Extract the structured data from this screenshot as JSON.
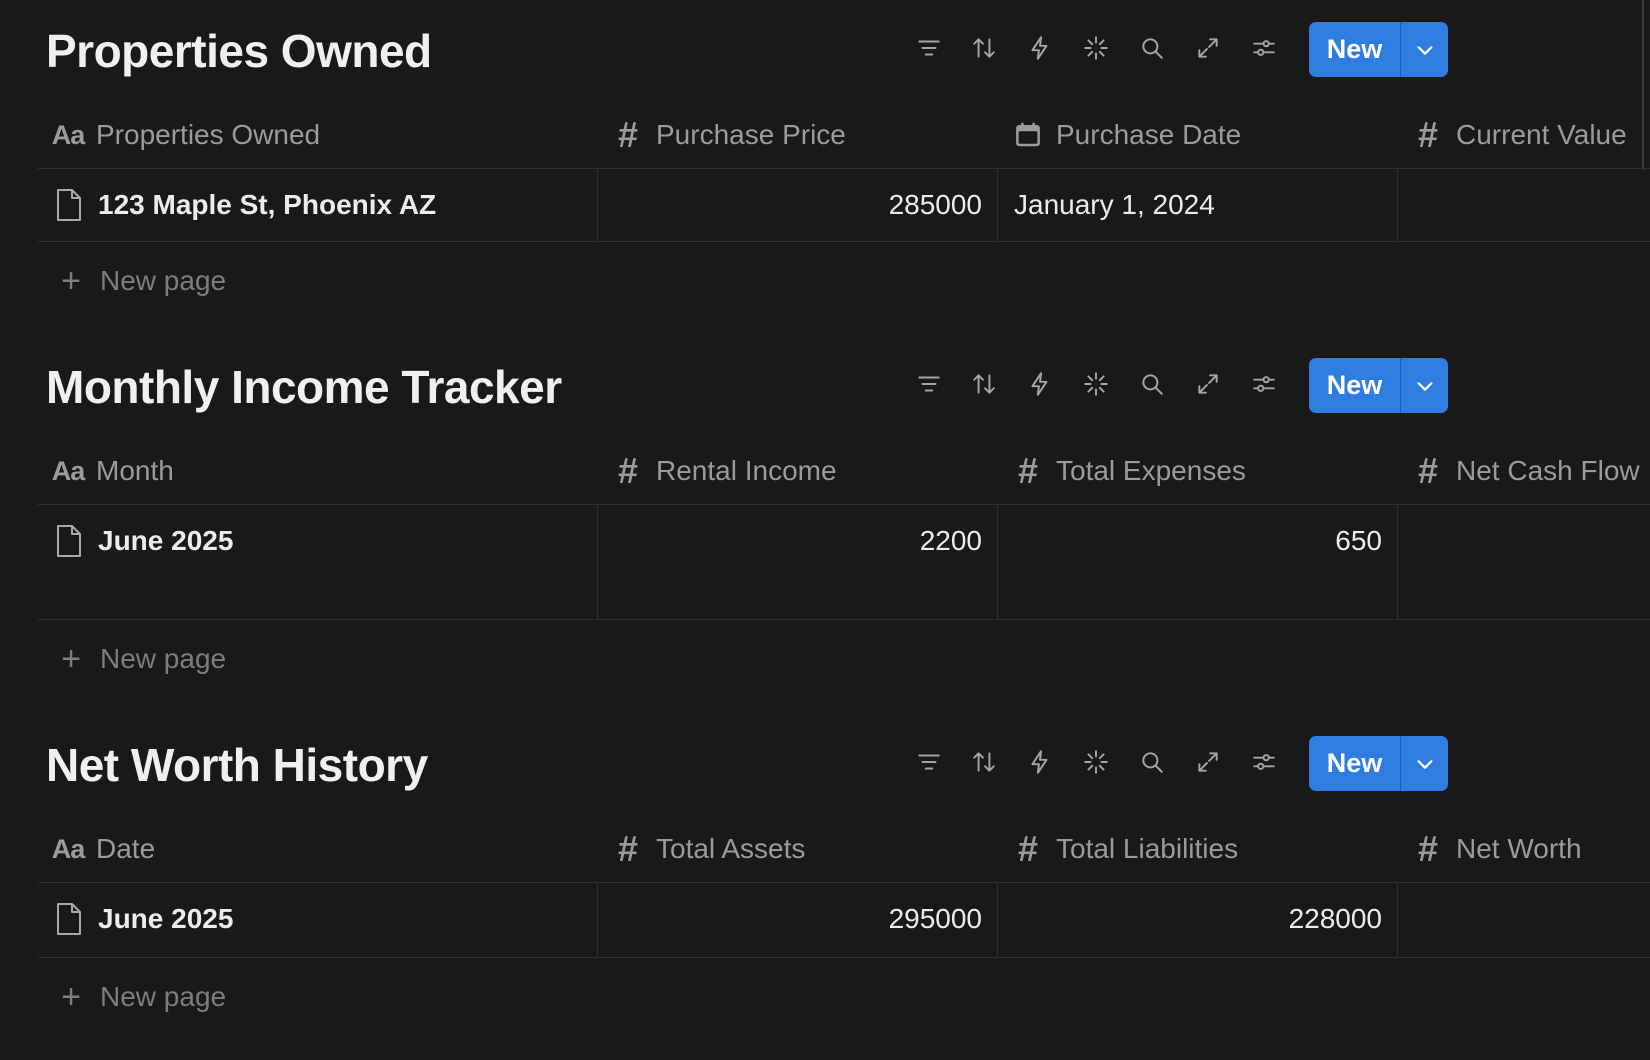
{
  "databases": [
    {
      "title": "Properties Owned",
      "new_label": "New",
      "columns": [
        {
          "icon": "text-icon",
          "icon_text": "Aa",
          "label": "Properties Owned"
        },
        {
          "icon": "number-icon",
          "icon_text": "#",
          "label": "Purchase Price"
        },
        {
          "icon": "calendar-icon",
          "icon_text": "",
          "label": "Purchase Date"
        },
        {
          "icon": "number-icon",
          "icon_text": "#",
          "label": "Current Value"
        }
      ],
      "rows": [
        {
          "name": "123 Maple St, Phoenix AZ",
          "c1": "285000",
          "c2": "January 1, 2024",
          "c3": ""
        }
      ],
      "new_page_label": "New page"
    },
    {
      "title": "Monthly Income Tracker",
      "new_label": "New",
      "columns": [
        {
          "icon": "text-icon",
          "icon_text": "Aa",
          "label": "Month"
        },
        {
          "icon": "number-icon",
          "icon_text": "#",
          "label": "Rental Income"
        },
        {
          "icon": "number-icon",
          "icon_text": "#",
          "label": "Total Expenses"
        },
        {
          "icon": "number-icon",
          "icon_text": "#",
          "label": "Net Cash Flow"
        }
      ],
      "rows": [
        {
          "name": "June 2025",
          "c1": "2200",
          "c2": "650",
          "c3": ""
        }
      ],
      "new_page_label": "New page"
    },
    {
      "title": "Net Worth History",
      "new_label": "New",
      "columns": [
        {
          "icon": "text-icon",
          "icon_text": "Aa",
          "label": "Date"
        },
        {
          "icon": "number-icon",
          "icon_text": "#",
          "label": "Total Assets"
        },
        {
          "icon": "number-icon",
          "icon_text": "#",
          "label": "Total Liabilities"
        },
        {
          "icon": "number-icon",
          "icon_text": "#",
          "label": "Net Worth"
        }
      ],
      "rows": [
        {
          "name": "June 2025",
          "c1": "295000",
          "c2": "228000",
          "c3": ""
        }
      ],
      "new_page_label": "New page"
    }
  ],
  "toolbar_icons": [
    "filter-icon",
    "sort-icon",
    "automation-icon",
    "ai-sparkle-icon",
    "search-icon",
    "expand-icon",
    "settings-icon"
  ],
  "colors": {
    "background": "#191919",
    "accent": "#2f7de1",
    "text": "#ececec",
    "muted": "#9b9b9b",
    "divider": "#2f2f2f"
  }
}
